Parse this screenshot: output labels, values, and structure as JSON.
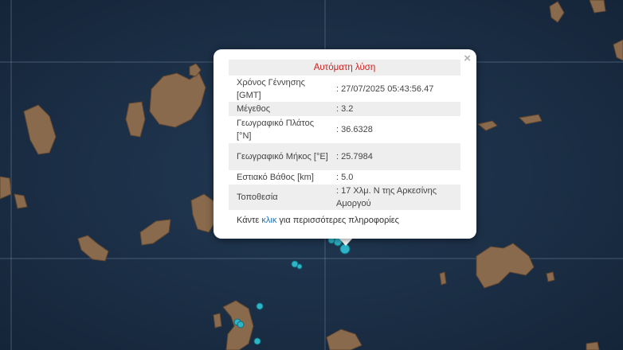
{
  "popup": {
    "title": "Αυτόματη λύση",
    "close_symbol": "×",
    "rows": [
      {
        "label": "Χρόνος Γέννησης [GMT]",
        "value": ": 27/07/2025 05:43:56.47"
      },
      {
        "label": "Μέγεθος",
        "value": ": 3.2"
      },
      {
        "label": "Γεωγραφικό Πλάτος [°N]",
        "value": ": 36.6328"
      },
      {
        "label": "Γεωγραφικό Μήκος [°E]",
        "value": ": 25.7984"
      },
      {
        "label": "Εστιακό Βάθος [km]",
        "value": ": 5.0"
      },
      {
        "label": "Τοποθεσία",
        "value": ": 17 Χλμ. Ν της Αρκεσίνης Αμοργού"
      }
    ],
    "more_prefix": "Κάντε ",
    "more_link": "κλικ",
    "more_suffix": " για περισσότερες πληροφορίες"
  },
  "colors": {
    "sea": "#1a2d44",
    "land": "#8a6a4c",
    "quake_marker": "#2fb3c6",
    "title_text": "#cc2222",
    "link": "#1f6fb5"
  }
}
